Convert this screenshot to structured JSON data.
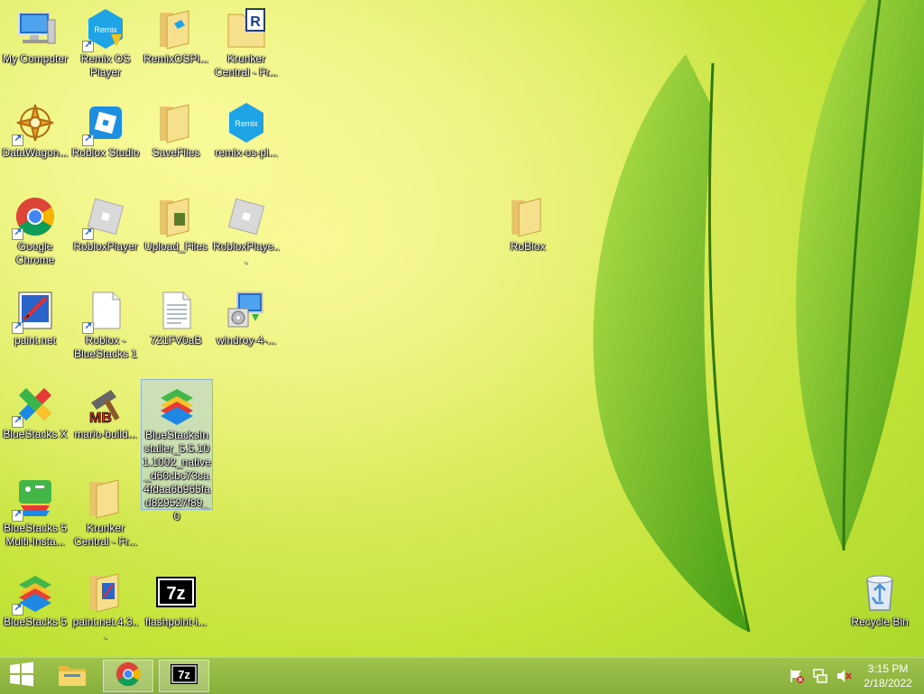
{
  "desktop": {
    "icons": [
      {
        "label": "My Computer",
        "icon": "computer-icon"
      },
      {
        "label": "Remix OS Player",
        "icon": "remix-os-player-icon"
      },
      {
        "label": "RemixOSPl...",
        "icon": "folder-icon"
      },
      {
        "label": "Krunker Central - Fr...",
        "icon": "krunker-icon"
      },
      {
        "label": "DataWagon...",
        "icon": "datawagon-icon"
      },
      {
        "label": "Roblox Studio",
        "icon": "roblox-studio-icon"
      },
      {
        "label": "SaveFiles",
        "icon": "folder-icon"
      },
      {
        "label": "remix-os-pl...",
        "icon": "remix-os-icon"
      },
      {
        "label": "Google Chrome",
        "icon": "chrome-icon"
      },
      {
        "label": "RobloxPlayer",
        "icon": "roblox-icon"
      },
      {
        "label": "Upload_Files",
        "icon": "folder-icon"
      },
      {
        "label": "RobloxPlaye...",
        "icon": "roblox-icon"
      },
      {
        "label": "paint.net",
        "icon": "paintnet-icon"
      },
      {
        "label": "Roblox - BlueStacks 1",
        "icon": "file-icon"
      },
      {
        "label": "721FV0aB",
        "icon": "text-file-icon"
      },
      {
        "label": "windroy-4-...",
        "icon": "installer-icon"
      },
      {
        "label": "BlueStacks X",
        "icon": "bluestacks-x-icon"
      },
      {
        "label": "mario-build...",
        "icon": "mario-builder-icon"
      },
      {
        "label": "BlueStacksInstaller_5.5.101.1002_native_d60cbc73ca4fdaa6b965fad829527f89_0",
        "icon": "bluestacks-icon"
      },
      {
        "label": "BlueStacks 5 Multi-Insta...",
        "icon": "bluestacks-multi-icon"
      },
      {
        "label": "Krunker Central - Fr...",
        "icon": "folder-icon"
      },
      {
        "label": "BlueStacks 5",
        "icon": "bluestacks-icon"
      },
      {
        "label": "paint.net.4.3...",
        "icon": "paintnet-folder-icon"
      },
      {
        "label": "flashpoint-i...",
        "icon": "7zip-icon"
      },
      {
        "label": "RoBlox",
        "icon": "folder-icon"
      },
      {
        "label": "Recycle Bin",
        "icon": "recycle-bin-icon"
      }
    ]
  },
  "taskbar": {
    "buttons": [
      {
        "name": "start",
        "icon": "windows-icon"
      },
      {
        "name": "file-explorer",
        "icon": "file-explorer-icon"
      },
      {
        "name": "google-chrome",
        "icon": "chrome-icon"
      },
      {
        "name": "7-zip",
        "icon": "7zip-icon"
      }
    ],
    "tray": {
      "icons": [
        "action-center-icon",
        "network-icon",
        "volume-muted-icon"
      ],
      "time": "3:15 PM",
      "date": "2/18/2022"
    }
  }
}
